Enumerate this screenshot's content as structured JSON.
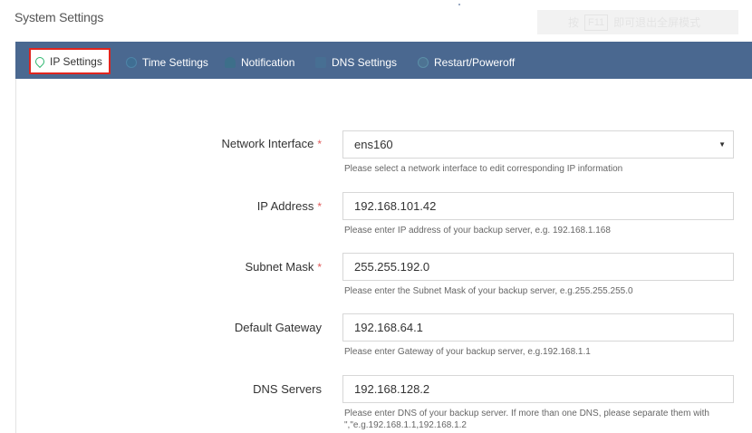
{
  "page": {
    "title": "System Settings"
  },
  "fullscreen_hint": {
    "prefix": "按",
    "key": "F11",
    "suffix": "即可退出全屏模式"
  },
  "tabs": [
    {
      "label": "IP Settings",
      "icon": "location-pin-icon",
      "active": true
    },
    {
      "label": "Time Settings",
      "icon": "clock-icon",
      "active": false
    },
    {
      "label": "Notification",
      "icon": "bell-icon",
      "active": false
    },
    {
      "label": "DNS Settings",
      "icon": "dns-icon",
      "active": false
    },
    {
      "label": "Restart/Poweroff",
      "icon": "power-icon",
      "active": false
    }
  ],
  "form": {
    "network_interface": {
      "label": "Network Interface",
      "required_mark": "*",
      "value": "ens160",
      "hint": "Please select a network interface to edit corresponding IP information"
    },
    "ip_address": {
      "label": "IP Address",
      "required_mark": "*",
      "value": "192.168.101.42",
      "hint": "Please enter IP address of your backup server, e.g. 192.168.1.168"
    },
    "subnet_mask": {
      "label": "Subnet Mask",
      "required_mark": "*",
      "value": "255.255.192.0",
      "hint": "Please enter the Subnet Mask of your backup server, e.g.255.255.255.0"
    },
    "default_gateway": {
      "label": "Default Gateway",
      "value": "192.168.64.1",
      "hint": "Please enter Gateway of your backup server, e.g.192.168.1.1"
    },
    "dns_servers": {
      "label": "DNS Servers",
      "value": "192.168.128.2",
      "hint_line1": "Please enter DNS of your backup server. If more than one DNS, please separate them with",
      "hint_line2": "\",\"e.g.192.168.1.1,192.168.1.2"
    }
  },
  "colors": {
    "tabbar": "#4a6890",
    "active_outline": "#e0251e",
    "required": "#e05b5b"
  }
}
